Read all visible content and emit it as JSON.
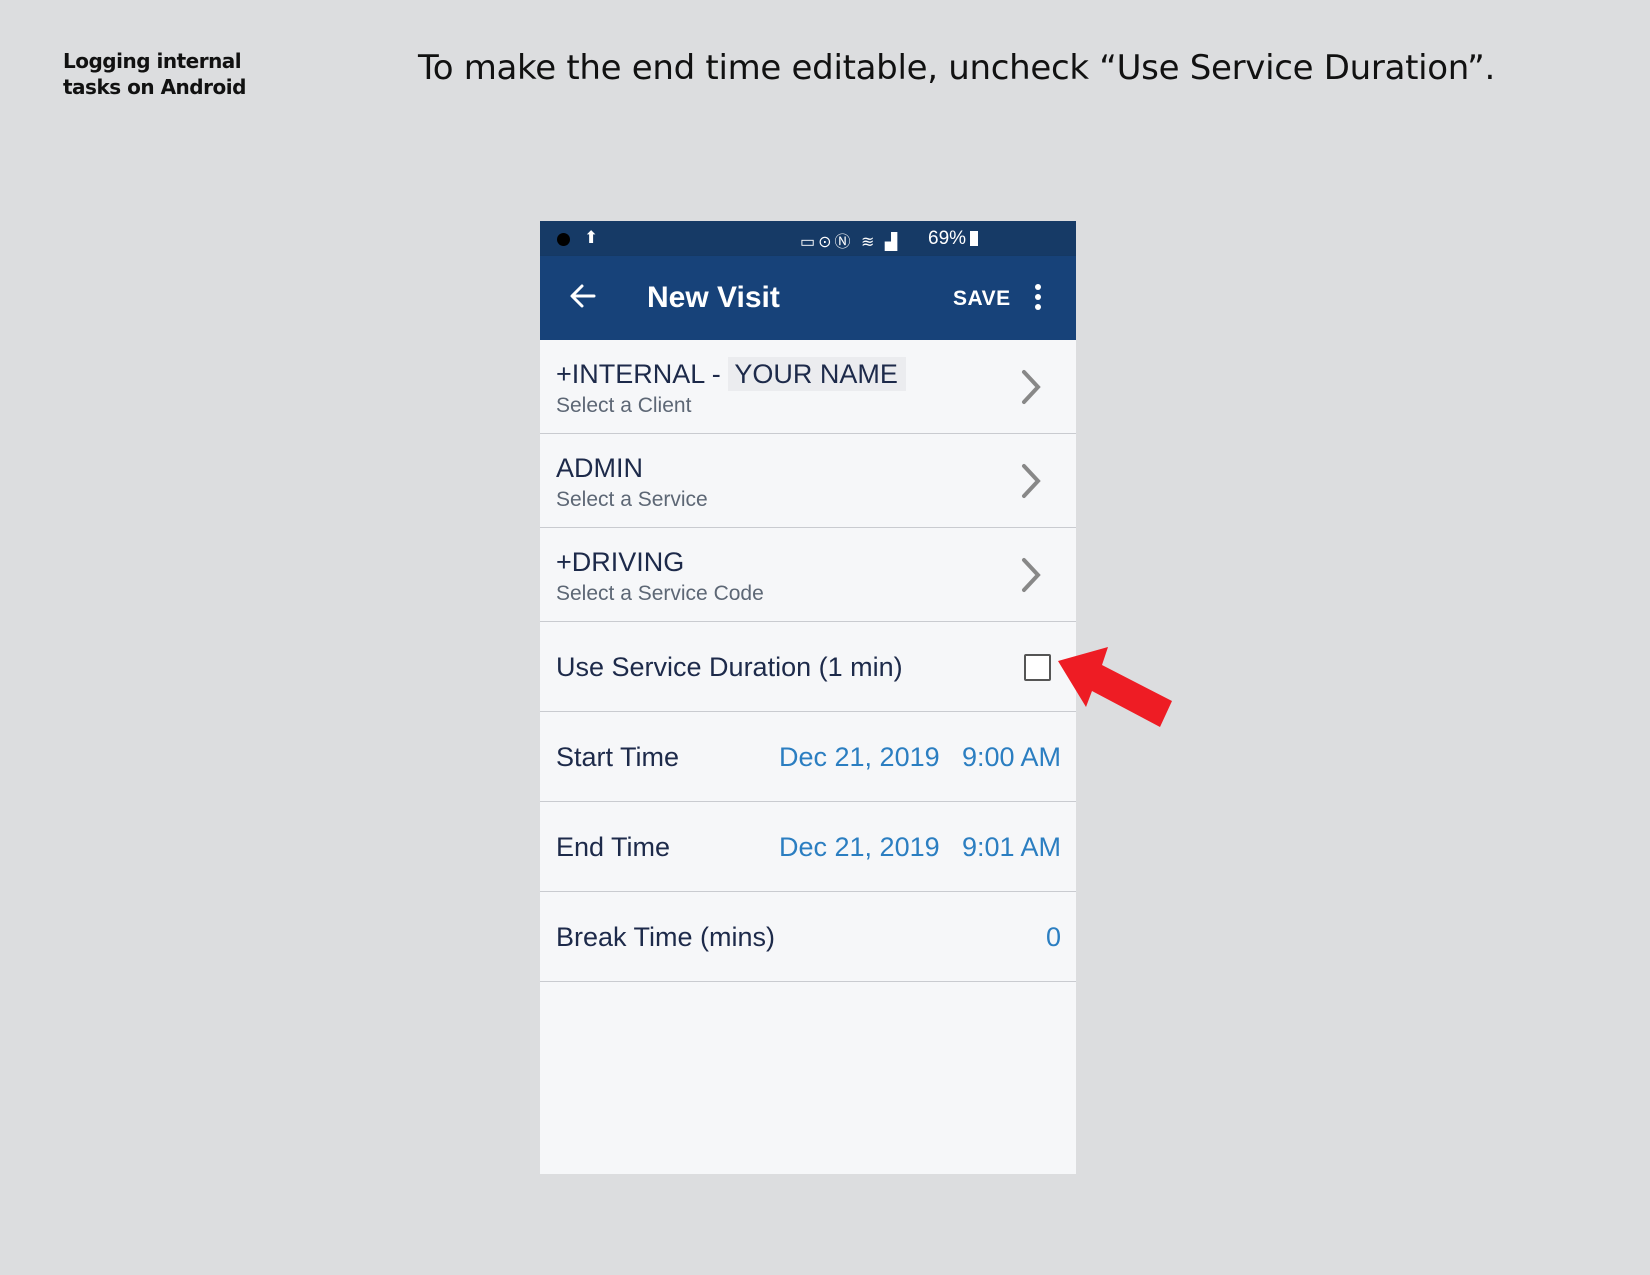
{
  "doc": {
    "side_title": "Logging internal tasks on Android",
    "headline": "To make the end time editable, uncheck “Use Service Duration”."
  },
  "status_bar": {
    "battery": "69%"
  },
  "app_bar": {
    "title": "New Visit",
    "save_label": "SAVE"
  },
  "form": {
    "client": {
      "prefix": "+INTERNAL -",
      "name": "YOUR NAME",
      "hint": "Select a Client"
    },
    "service": {
      "value": "ADMIN",
      "hint": "Select a Service"
    },
    "service_code": {
      "value": "+DRIVING",
      "hint": "Select a Service Code"
    },
    "use_service_duration": {
      "label": "Use Service Duration (1 min)",
      "checked": false
    },
    "start_time": {
      "label": "Start Time",
      "date": "Dec 21, 2019",
      "time": "9:00 AM"
    },
    "end_time": {
      "label": "End Time",
      "date": "Dec 21, 2019",
      "time": "9:01 AM"
    },
    "break_time": {
      "label": "Break Time (mins)",
      "value": "0"
    }
  },
  "colors": {
    "app_bar": "#174279",
    "status_bar": "#163a66",
    "accent_value": "#2b7ec1",
    "callout_arrow": "#ee1c24"
  },
  "icons": [
    "back-arrow-icon",
    "more-vert-icon",
    "chevron-right-icon",
    "checkbox-icon",
    "red-pointer-arrow"
  ]
}
